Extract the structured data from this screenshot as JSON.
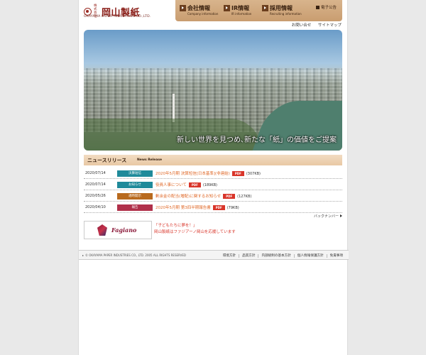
{
  "header": {
    "logo_sub": "株式会社",
    "logo_name": "岡山製紙",
    "logo_en": "OKAYAMA PAPER INDUSTRIES CO.,LTD.",
    "nav": [
      {
        "label": "会社情報",
        "en": "Company information"
      },
      {
        "label": "IR情報",
        "en": "IR information"
      },
      {
        "label": "採用情報",
        "en": "Recruiting information"
      }
    ],
    "notice": "電子公告",
    "utility": [
      "お問い合せ",
      "サイトマップ"
    ]
  },
  "hero": {
    "caption": "新しい世界を見つめ､新たな「紙」の価値をご提案"
  },
  "news": {
    "title": "ニュースリリース",
    "title_en": "News Release",
    "items": [
      {
        "date": "2020/07/14",
        "category": "決算短信",
        "category_color": "#1f8a9a",
        "text": "2020年5月期 決算短信[日本基準](非連結)",
        "pdf": "PDF",
        "size": "(307KB)"
      },
      {
        "date": "2020/07/14",
        "category": "お知らせ",
        "category_color": "#1f8a9a",
        "text": "役員人事について",
        "pdf": "PDF",
        "size": "(189KB)"
      },
      {
        "date": "2020/05/26",
        "category": "適時開示",
        "category_color": "#b86a1e",
        "text": "剰余金の配当(増配)に関するお知らせ",
        "pdf": "PDF",
        "size": "(127KB)"
      },
      {
        "date": "2020/04/10",
        "category": "報告",
        "category_color": "#b0304a",
        "text": "2020年5月期 第3四半期報告書",
        "pdf": "PDF",
        "size": "(79KB)"
      }
    ],
    "back_number": "バックナンバー"
  },
  "banner": {
    "logo_text": "Fagiano",
    "message_line1": "「子どもたちに夢を！」",
    "message_line2": "岡山製紙はファジアーノ岡山を応援しています"
  },
  "footer": {
    "copyright": "© OKAYAMA PAPER INDUSTRIES CO., LTD. 2005 ALL RIGHTS RESERVED",
    "links": [
      "環境方針",
      "品質方針",
      "内部統制の基本方針",
      "個人情報保護方針",
      "免責事項"
    ]
  },
  "colors": {
    "nav_bg": "#c99d70",
    "news_link": "#e06a2a",
    "pdf_badge": "#d9352a"
  }
}
